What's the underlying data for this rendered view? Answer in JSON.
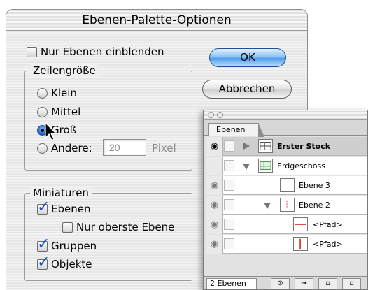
{
  "dialog": {
    "title": "Ebenen-Palette-Optionen",
    "show_layers_only": {
      "label": "Nur Ebenen einblenden",
      "checked": false
    },
    "row_size": {
      "legend": "Zeilengröße",
      "options": [
        {
          "label": "Klein",
          "selected": false
        },
        {
          "label": "Mittel",
          "selected": false
        },
        {
          "label": "Groß",
          "selected": true
        },
        {
          "label": "Andere:",
          "selected": false
        }
      ],
      "custom_value": "20",
      "unit": "Pixel"
    },
    "thumbnails": {
      "legend": "Miniaturen",
      "layers": {
        "label": "Ebenen",
        "checked": true
      },
      "top_level_only": {
        "label": "Nur oberste Ebene",
        "checked": false
      },
      "groups": {
        "label": "Gruppen",
        "checked": true
      },
      "objects": {
        "label": "Objekte",
        "checked": true
      }
    },
    "ok_label": "OK",
    "cancel_label": "Abbrechen"
  },
  "palette": {
    "tab_label": "Ebenen",
    "window_dots": [
      "○",
      "○"
    ],
    "rows": [
      {
        "label": "Erster Stock",
        "selected": true,
        "eye": "◉"
      },
      {
        "label": "Erdgeschoss",
        "selected": false,
        "eye": ""
      },
      {
        "label": "Ebene 3",
        "selected": false,
        "eye": "◉"
      },
      {
        "label": "Ebene 2",
        "selected": false,
        "eye": "◉"
      },
      {
        "label": "<Pfad>",
        "selected": false,
        "eye": "◉"
      },
      {
        "label": "<Pfad>",
        "selected": false,
        "eye": "◉"
      }
    ],
    "footer_count": "2 Ebenen",
    "colors": {
      "path_line": "#e03a2a",
      "selection_bg": "#cfcfcf",
      "thumb_accent": "#2e8b2e"
    }
  }
}
